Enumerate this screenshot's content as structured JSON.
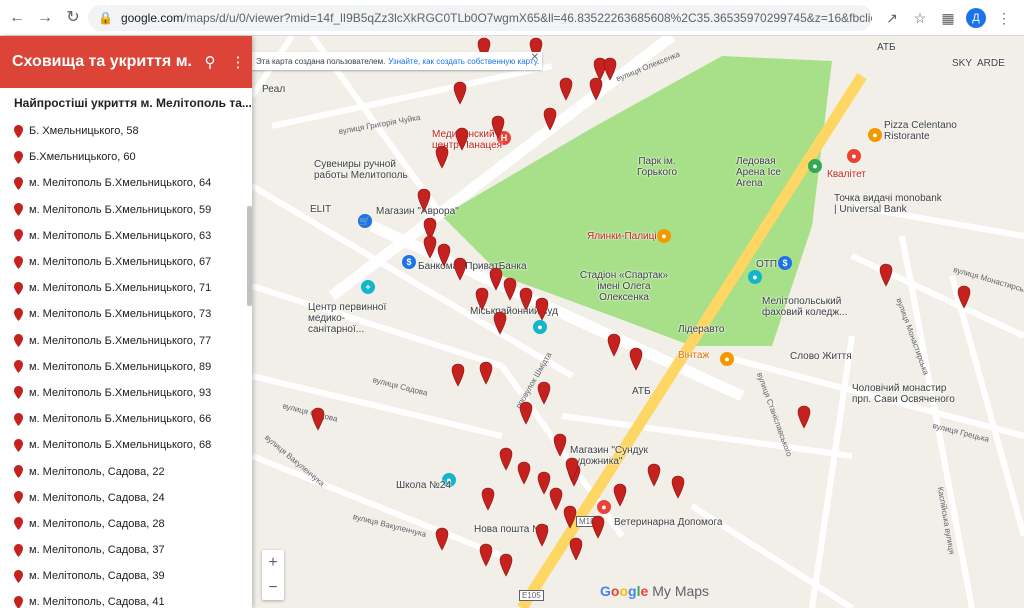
{
  "browser": {
    "url_host": "google.com",
    "url_path": "/maps/d/u/0/viewer?mid=14f_lI9B5qZz3lcXkRGC0TLb0O7wgmX65&ll=46.83522263685608%2C35.36535970299745&z=16&fbclid=IwAR3JXIOpp3lCHBU2YHkX-Djln2WZSmDurtJNvK5INnvJ6caLB0kK...",
    "profile_letter": "Д"
  },
  "panel": {
    "title": "Сховища та укриття м. ...",
    "layer_title": "Найпростіші укриття м. Мелітополь та...",
    "items": [
      "Б. Хмельницького, 58",
      "Б.Хмельницького, 60",
      "м. Мелітополь Б.Хмельницького, 64",
      "м. Мелітополь Б.Хмельницького, 59",
      "м. Мелітополь Б.Хмельницького, 63",
      "м. Мелітополь Б.Хмельницького, 67",
      "м. Мелітополь Б.Хмельницького, 71",
      "м. Мелітополь Б.Хмельницького, 73",
      "м. Мелітополь Б.Хмельницького, 77",
      "м. Мелітополь Б.Хмельницького, 89",
      "м. Мелітополь Б.Хмельницького, 93",
      "м. Мелітополь Б.Хмельницького, 66",
      "м. Мелітополь Б.Хмельницького, 68",
      "м. Мелітополь, Садова, 22",
      "м. Мелітополь, Садова, 24",
      "м. Мелітополь, Садова, 28",
      "м. Мелітополь, Садова, 37",
      "м. Мелітополь, Садова, 39",
      "м. Мелітополь, Садова, 41"
    ]
  },
  "banner": {
    "text": "Эта карта создана пользователем.",
    "link": "Узнайте, как создать собственную карту."
  },
  "labels": {
    "medcenter": "Медицинский центр Панацея",
    "suvenir": "Сувениры ручной работы Мелитополь",
    "avrora": "Магазин \"Аврора\"",
    "elit": "ELIT",
    "real": "Реал",
    "bank": "Банкомат ПриватБанка",
    "park": "Парк ім. Горького",
    "arena": "Ледовая Арена Ice Arena",
    "pizza": "Pizza Celentano Ristorante",
    "kvalitet": "Квалітет",
    "monobank": "Точка видачі monobank | Universal Bank",
    "yalynky": "Ялинки-Палиці",
    "stadion": "Стадіон «Спартак» імені Олега Олексенка",
    "otp": "ОТП",
    "college": "Мелітопольський фаховий коледж...",
    "center": "Центр первинної медико-санітарної...",
    "sud": "Міськрайонний суд",
    "liderav": "Лідеравто",
    "vintazh": "Вінтаж",
    "slovo": "Слово Життя",
    "monastyr": "Чоловічий монастир прп. Сави Освяченого",
    "atb1": "АТБ",
    "atb2": "АТБ",
    "sunduk": "Магазин \"Сундук художника\"",
    "school": "Школа №24",
    "nova": "Нова пошта №2",
    "vet": "Ветеринарна Допомога",
    "sky": "SKY",
    "ardb": "ARDE"
  },
  "streets": {
    "oleksenka": "вулиця Олексенка",
    "hryhoriia": "вулиця Григорія Чуйка",
    "shmidta": "провулок Шмідта",
    "sadova1": "вулиця Садова",
    "sadova2": "вулиця Садова",
    "vakulenchuka1": "вулиця Вакуленчука",
    "vakulenchuka2": "вулиця Вакуленчука",
    "monastyrska1": "вулиця Монастирська",
    "monastyrska2": "вулиця Монастирська",
    "hretska": "вулиця Грецька",
    "kaspiiska": "Каспійська вулиця",
    "stanislavskoho": "вулиця Станіславського",
    "e105": "E105",
    "m18": "M18"
  },
  "map_credit": {
    "google": [
      "G",
      "o",
      "o",
      "g",
      "l",
      "e"
    ],
    "my_maps": "My Maps"
  },
  "zoom": {
    "plus": "+",
    "minus": "−"
  },
  "colors": {
    "header": "#db4437",
    "pin": "#c5221f",
    "park": "#a8e08a",
    "road_major": "#fdd663"
  }
}
